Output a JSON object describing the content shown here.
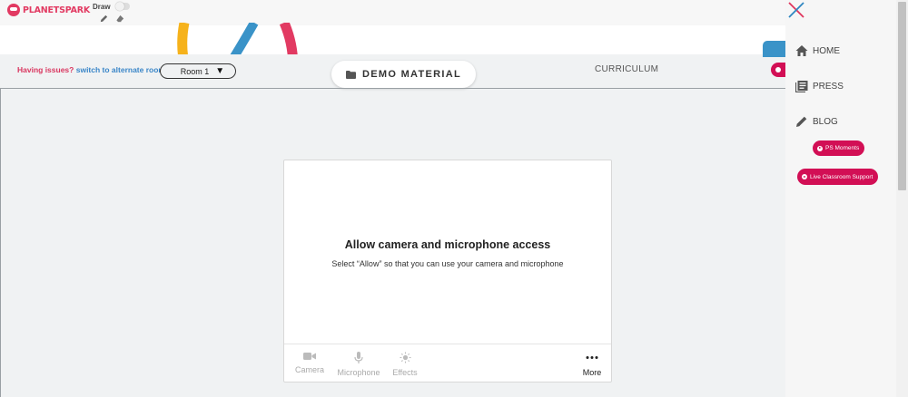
{
  "header": {
    "logo_text": "PLANETSPARK",
    "draw_label": "Draw",
    "draw_enabled": false
  },
  "toolbar": {
    "issues_question": "Having issues?",
    "issues_link": "switch to alternate room",
    "room_selected": "Room 1",
    "room_caret": "▼",
    "demo_material_label": "DEMO MATERIAL",
    "curriculum_label": "CURRICULUM"
  },
  "permission_card": {
    "title": "Allow camera and microphone access",
    "subtitle": "Select “Allow” so that you can use your camera and microphone",
    "controls": [
      {
        "label": "Camera",
        "icon": "camera-icon"
      },
      {
        "label": "Microphone",
        "icon": "microphone-icon"
      },
      {
        "label": "Effects",
        "icon": "effects-icon"
      },
      {
        "label": "More",
        "icon": "more-dots-icon"
      }
    ]
  },
  "drawer": {
    "nav": [
      {
        "label": "HOME",
        "icon": "home-icon"
      },
      {
        "label": "PRESS",
        "icon": "press-icon"
      },
      {
        "label": "BLOG",
        "icon": "pencil-icon"
      }
    ],
    "ps_moments_label": "PS Moments",
    "live_support_label": "Live Classroom Support"
  },
  "colors": {
    "brand_red": "#d20f55",
    "logo_pink": "#e23a62",
    "link_blue": "#3a86c8",
    "panel_gray": "#f0f2f3",
    "close_red": "#e0345c",
    "close_blue": "#2e86c1"
  }
}
